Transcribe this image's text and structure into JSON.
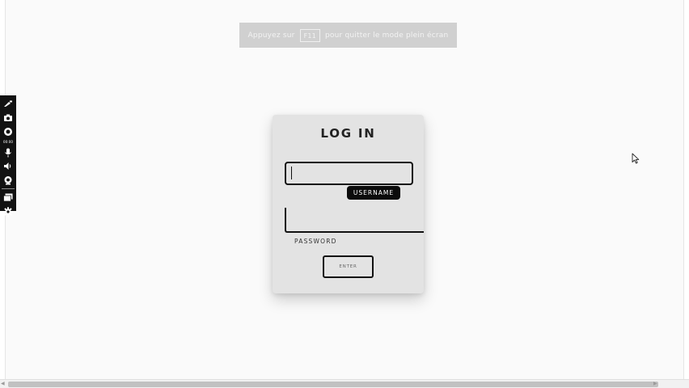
{
  "fullscreen_notice": {
    "before_key": "Appuyez sur",
    "key": "F11",
    "after_key": "pour quitter le mode plein écran"
  },
  "recorder_toolbar": {
    "timer": "00:00",
    "icons": [
      "pen-icon",
      "camera-icon",
      "record-icon",
      "microphone-icon",
      "speaker-icon",
      "webcam-icon",
      "window-icon",
      "settings-icon"
    ]
  },
  "login": {
    "title": "LOG IN",
    "username_label": "USERNAME",
    "username_value": "",
    "password_label": "PASSWORD",
    "password_value": "",
    "enter_label": "ENTER"
  },
  "colors": {
    "page_background": "#fafafa",
    "card_background": "#e3e3e3",
    "accent_dark": "#111111",
    "banner_background": "#d0d0d0"
  }
}
